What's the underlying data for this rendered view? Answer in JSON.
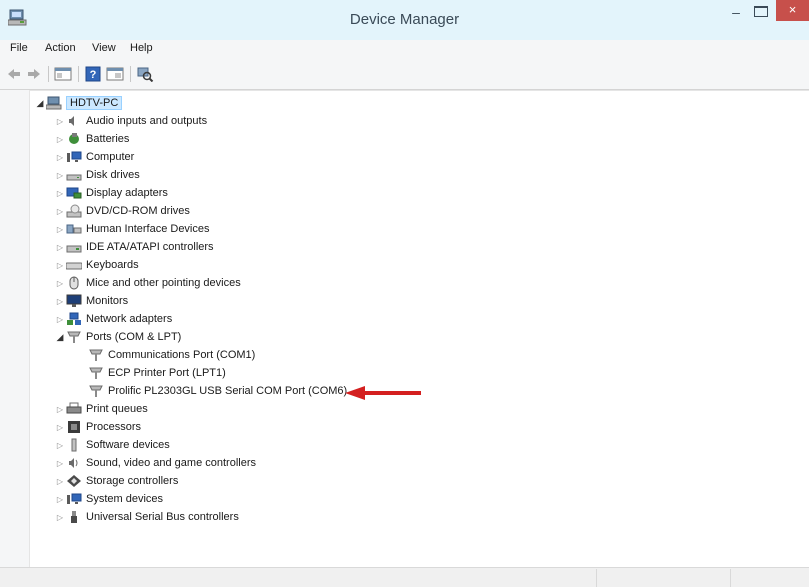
{
  "window": {
    "title": "Device Manager",
    "minimize_glyph": "–",
    "close_glyph": "×"
  },
  "menu": [
    "File",
    "Action",
    "View",
    "Help"
  ],
  "toolbar": {
    "buttons": [
      "back-arrow-icon",
      "forward-arrow-icon",
      "show-hide-console-tree-icon",
      "help-icon",
      "properties-icon",
      "scan-hardware-icon"
    ]
  },
  "tree": {
    "root": {
      "label": "HDTV-PC",
      "icon": "computer-icon"
    },
    "categories": [
      {
        "label": "Audio inputs and outputs",
        "icon": "speaker-icon"
      },
      {
        "label": "Batteries",
        "icon": "battery-icon"
      },
      {
        "label": "Computer",
        "icon": "computer-icon"
      },
      {
        "label": "Disk drives",
        "icon": "disk-drive-icon"
      },
      {
        "label": "Display adapters",
        "icon": "display-adapter-icon"
      },
      {
        "label": "DVD/CD-ROM drives",
        "icon": "dvd-drive-icon"
      },
      {
        "label": "Human Interface Devices",
        "icon": "hid-icon"
      },
      {
        "label": "IDE ATA/ATAPI controllers",
        "icon": "ide-controller-icon"
      },
      {
        "label": "Keyboards",
        "icon": "keyboard-icon"
      },
      {
        "label": "Mice and other pointing devices",
        "icon": "mouse-icon"
      },
      {
        "label": "Monitors",
        "icon": "monitor-icon"
      },
      {
        "label": "Network adapters",
        "icon": "network-adapter-icon"
      },
      {
        "label": "Ports (COM & LPT)",
        "icon": "port-icon"
      },
      {
        "label": "Print queues",
        "icon": "printer-icon"
      },
      {
        "label": "Processors",
        "icon": "processor-icon"
      },
      {
        "label": "Software devices",
        "icon": "software-device-icon"
      },
      {
        "label": "Sound, video and game controllers",
        "icon": "sound-controller-icon"
      },
      {
        "label": "Storage controllers",
        "icon": "storage-controller-icon"
      },
      {
        "label": "System devices",
        "icon": "system-devices-icon"
      },
      {
        "label": "Universal Serial Bus controllers",
        "icon": "usb-icon"
      }
    ],
    "ports_children": [
      {
        "label": "Communications Port (COM1)",
        "icon": "port-icon"
      },
      {
        "label": "ECP Printer Port (LPT1)",
        "icon": "port-icon"
      },
      {
        "label": "Prolific PL2303GL USB Serial COM Port (COM6)",
        "icon": "port-icon"
      }
    ],
    "expander_collapsed": "▷",
    "expander_expanded": "◢"
  },
  "annotation": {
    "icon": "red-arrow-icon",
    "color": "#d42020"
  }
}
